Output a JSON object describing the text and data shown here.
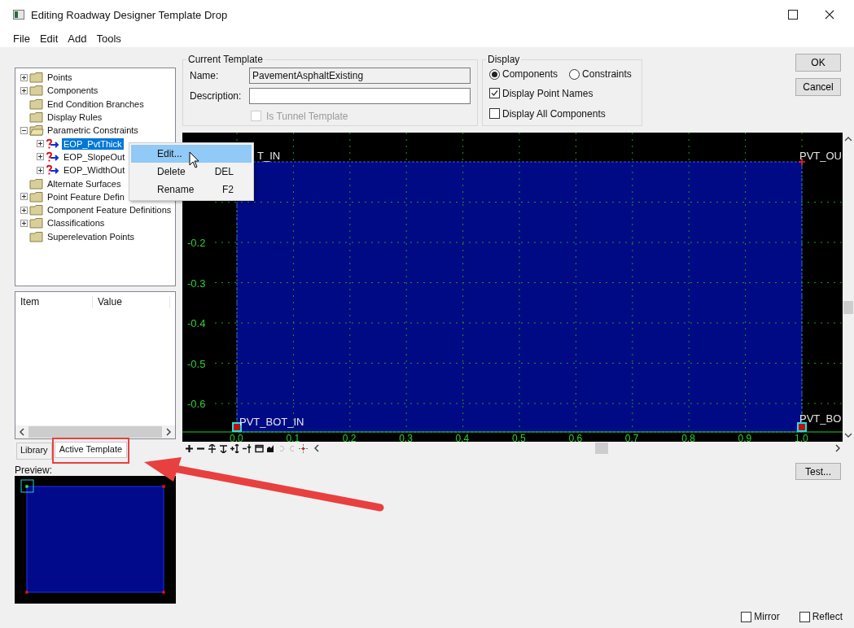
{
  "window": {
    "title": "Editing Roadway Designer Template Drop"
  },
  "menu": [
    "File",
    "Edit",
    "Add",
    "Tools"
  ],
  "tree": [
    {
      "label": "Points",
      "kind": "folder",
      "expanded": false,
      "selected": false
    },
    {
      "label": "Components",
      "kind": "folder",
      "expanded": false,
      "selected": false
    },
    {
      "label": "End Condition Branches",
      "kind": "folder",
      "selected": false
    },
    {
      "label": "Display Rules",
      "kind": "folder",
      "selected": false
    },
    {
      "label": "Parametric Constraints",
      "kind": "folder",
      "expanded": true,
      "selected": false,
      "children": [
        {
          "label": "EOP_PvtThick",
          "kind": "constraint",
          "expanded": false,
          "selected": true
        },
        {
          "label": "EOP_SlopeOut",
          "kind": "constraint",
          "expanded": false,
          "selected": false
        },
        {
          "label": "EOP_WidthOut",
          "kind": "constraint",
          "expanded": false,
          "selected": false
        }
      ]
    },
    {
      "label": "Alternate Surfaces",
      "kind": "folder",
      "selected": false
    },
    {
      "label": "Point Feature Defin",
      "kind": "folder",
      "expanded": false,
      "selected": false
    },
    {
      "label": "Component Feature Definitions",
      "kind": "folder",
      "expanded": false,
      "selected": false
    },
    {
      "label": "Classifications",
      "kind": "folder",
      "expanded": false,
      "selected": false
    },
    {
      "label": "Superelevation Points",
      "kind": "folder",
      "selected": false
    }
  ],
  "context_menu": [
    {
      "label": "Edit...",
      "selected": true
    },
    {
      "label": "Delete",
      "shortcut": "DEL",
      "selected": false
    },
    {
      "label": "Rename",
      "shortcut": "F2",
      "selected": false
    }
  ],
  "properties": {
    "columns": [
      "Item",
      "Value"
    ]
  },
  "tabs": [
    {
      "label": "Library",
      "selected": false
    },
    {
      "label": "Active Template",
      "selected": true
    }
  ],
  "preview": {
    "label": "Preview:"
  },
  "current_template": {
    "title": "Current Template",
    "name_label": "Name:",
    "name_value": "PavementAsphaltExisting",
    "description_label": "Description:",
    "tunnel": {
      "label": "Is Tunnel Template",
      "checked": false,
      "disabled": true
    }
  },
  "display": {
    "title": "Display",
    "radios": [
      {
        "label": "Components",
        "selected": true
      },
      {
        "label": "Constraints",
        "selected": false
      }
    ],
    "checkboxes": [
      {
        "label": "Display Point Names",
        "checked": true
      },
      {
        "label": "Display All Components",
        "checked": false
      }
    ]
  },
  "buttons": [
    "OK",
    "Cancel"
  ],
  "canvas": {
    "y_labels": [
      "-0.2",
      "-0.3",
      "-0.4",
      "-0.5",
      "-0.6"
    ],
    "x_labels": [
      "0.0",
      "0.1",
      "0.2",
      "0.3",
      "0.4",
      "0.5",
      "0.6",
      "0.7",
      "0.8",
      "0.9",
      "1.0"
    ],
    "points": [
      {
        "label": "T_IN"
      },
      {
        "label": "PVT_OU"
      },
      {
        "label": "PVT_BOT_IN"
      },
      {
        "label": "PVT_BO"
      }
    ]
  },
  "test_button": "Test...",
  "options": [
    {
      "label": "Mirror",
      "checked": false
    },
    {
      "label": "Reflect",
      "checked": false
    }
  ]
}
